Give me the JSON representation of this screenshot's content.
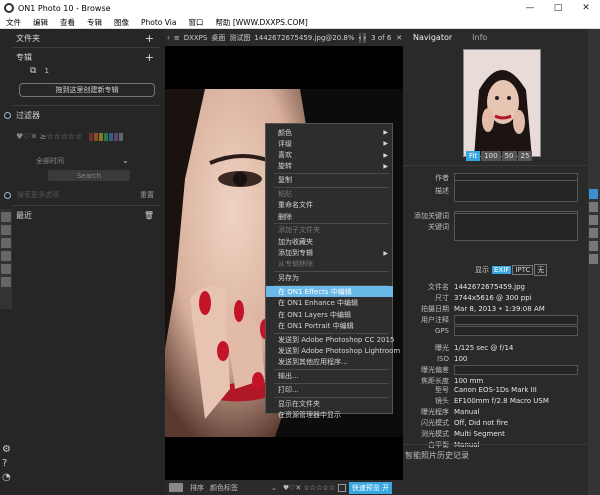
{
  "window": {
    "title": "ON1 Photo 10 - Browse",
    "controls": [
      "—",
      "□",
      "✕"
    ]
  },
  "menu": [
    "文件",
    "编辑",
    "查看",
    "专辑",
    "图像",
    "Photo Via",
    "窗口",
    "帮助 [WWW.DXXPS.COM]"
  ],
  "left": {
    "folders_label": "文件夹",
    "albums_label": "专辑",
    "album_count": "1",
    "drop_button": "拖到这里创建新专辑",
    "filter_label": "过滤器",
    "rating_symbols": "♥♡✕  ≥☆☆☆☆☆",
    "time_label": "全部时间",
    "search_button": "Search",
    "smart_search_label": "搜索更多选项",
    "reset_label": "重置",
    "recent_label": "最近",
    "filter_colors": [
      "#c0392b",
      "#e67e22",
      "#f1c40f",
      "#2ecc71",
      "#3498db",
      "#9b59b6",
      "#95a5a6"
    ]
  },
  "toolbar": {
    "crumb1": "DXXPS",
    "crumb2": "桌面",
    "crumb3": "测试图",
    "filename": "1442672675459.jpg@20.8%",
    "counter": "3 of 6"
  },
  "context_menu": {
    "items": [
      {
        "label": "颜色",
        "sub": true
      },
      {
        "label": "评级",
        "sub": true
      },
      {
        "label": "喜欢",
        "sub": true
      },
      {
        "label": "旋转",
        "sub": true
      },
      {
        "label": "复制"
      },
      {
        "label": "粘贴",
        "disabled": true
      },
      {
        "label": "重命名文件"
      },
      {
        "label": "删除"
      },
      {
        "label": "添加子文件夹",
        "disabled": true
      },
      {
        "label": "加为收藏夹"
      },
      {
        "label": "添加到专辑",
        "sub": true
      },
      {
        "label": "从专辑移除",
        "disabled": true
      },
      {
        "label": "另存为"
      },
      {
        "label": "在 ON1 Effects 中编辑",
        "highlight": true
      },
      {
        "label": "在 ON1 Enhance 中编辑"
      },
      {
        "label": "在 ON1 Layers 中编辑"
      },
      {
        "label": "在 ON1 Portrait 中编辑"
      },
      {
        "label": "发送到 Adobe Photoshop CC 2015"
      },
      {
        "label": "发送到 Adobe Photoshop Lightroom 6"
      },
      {
        "label": "发送到其他应用程序..."
      },
      {
        "label": "输出..."
      },
      {
        "label": "打印..."
      },
      {
        "label": "显示在文件夹"
      },
      {
        "label": "在资源管理器中显示"
      }
    ]
  },
  "bottom": {
    "sort_label": "排序",
    "color_tag_label": "颜色标签",
    "rating": "♥♡✕ ☆☆☆☆☆",
    "preview_button": "快速预览 开"
  },
  "right": {
    "tab_navigator": "Navigator",
    "tab_info": "Info",
    "zoom": [
      "Fit",
      "100",
      "50",
      "25"
    ],
    "author_label": "作者",
    "desc_label": "描述",
    "keywords_label": "添加关键词",
    "keywords2_label": "关键词",
    "display_label": "显示",
    "exif_btn": "EXIF",
    "iptc_btn": "IPTC",
    "none_btn": "无",
    "meta": [
      {
        "k": "文件名",
        "v": "1442672675459.jpg"
      },
      {
        "k": "尺寸",
        "v": "3744x5616 @ 300 ppi"
      },
      {
        "k": "拍摄日期",
        "v": "Mar 8, 2013 • 1:39:08 AM"
      },
      {
        "k": "用户注释",
        "v": ""
      },
      {
        "k": "GPS",
        "v": ""
      },
      {
        "k": "曝光",
        "v": "1/125 sec @ f/14"
      },
      {
        "k": "ISO",
        "v": "100"
      },
      {
        "k": "曝光偏差",
        "v": ""
      },
      {
        "k": "焦距长度",
        "v": "100 mm"
      },
      {
        "k": "型号",
        "v": "Canon EOS-1Ds Mark III"
      },
      {
        "k": "镜头",
        "v": "EF100mm f/2.8 Macro USM"
      },
      {
        "k": "曝光程序",
        "v": "Manual"
      },
      {
        "k": "闪光模式",
        "v": "Off, Did not fire"
      },
      {
        "k": "测光模式",
        "v": "Multi Segment"
      },
      {
        "k": "白平衡",
        "v": "Manual"
      }
    ],
    "history_label": "智能照片历史记录"
  }
}
